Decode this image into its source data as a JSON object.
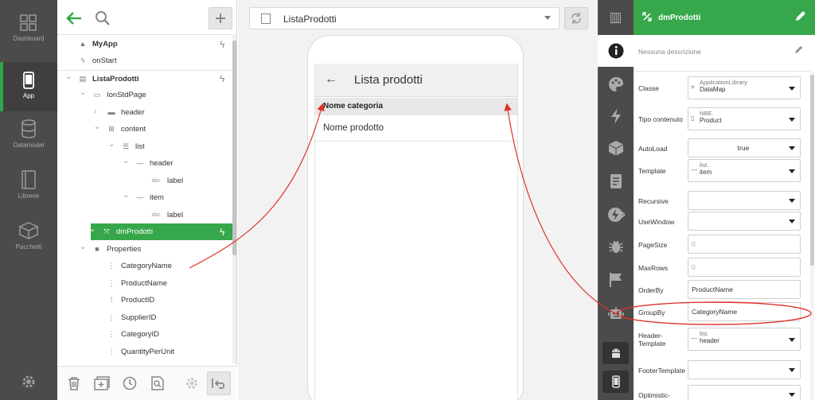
{
  "rail": {
    "items": [
      {
        "label": "Dashboard",
        "icon": "dashboard-icon"
      },
      {
        "label": "App",
        "icon": "phone-icon"
      },
      {
        "label": "Datamodel",
        "icon": "database-icon"
      },
      {
        "label": "Librerie",
        "icon": "book-icon"
      },
      {
        "label": "Pacchetti",
        "icon": "package-icon"
      }
    ],
    "active_index": 1,
    "settings_icon": "gear-icon"
  },
  "tree": {
    "nodes": [
      {
        "label": "MyApp",
        "icon": "rocket-icon",
        "bold": true,
        "badge": "lightning-doc-icon"
      },
      {
        "label": "onStart",
        "icon": "bolt-icon"
      },
      {
        "label": "ListaProdotti",
        "icon": "page-icon",
        "bold": true,
        "expanded": true,
        "badge": "lightning-doc-icon"
      },
      {
        "label": "IonStdPage",
        "icon": "frame-icon",
        "expanded": true
      },
      {
        "label": "header",
        "icon": "header-block-icon",
        "expanded": false
      },
      {
        "label": "content",
        "icon": "grid-icon",
        "expanded": true
      },
      {
        "label": "list",
        "icon": "list-icon",
        "expanded": true
      },
      {
        "label": "header",
        "icon": "dash-icon",
        "expanded": true
      },
      {
        "label": "label",
        "icon": "abc-icon",
        "prefix": "abc"
      },
      {
        "label": "item",
        "icon": "dash-icon",
        "expanded": true
      },
      {
        "label": "label",
        "icon": "abc-icon",
        "prefix": "abc"
      },
      {
        "label": "dmProdotti",
        "icon": "datamap-icon",
        "selected": true,
        "expanded": true,
        "badge": "lightning-doc-icon"
      },
      {
        "label": "Properties",
        "icon": "folder-icon",
        "expanded": true
      },
      {
        "label": "CategoryName",
        "icon": "field-icon"
      },
      {
        "label": "ProductName",
        "icon": "field-icon"
      },
      {
        "label": "ProductID",
        "icon": "key-field-icon"
      },
      {
        "label": "SupplierID",
        "icon": "field-icon"
      },
      {
        "label": "CategoryID",
        "icon": "field-icon"
      },
      {
        "label": "QuantityPerUnit",
        "icon": "field-icon"
      }
    ],
    "bottom_icons": [
      "trash-icon",
      "add-library-icon",
      "history-icon",
      "search-doc-icon",
      "gear-icon",
      "undo-icon"
    ]
  },
  "center": {
    "page_select": "ListaProdotti",
    "phone": {
      "title": "Lista prodotti",
      "group_header": "Nome categoria",
      "item": "Nome prodotto"
    }
  },
  "props": {
    "header_title": "dmProdotti",
    "description_placeholder": "Nessuna descrizione",
    "rows": [
      {
        "label": "Classe",
        "small": "ApplicationLibrary.",
        "main": "DataMap",
        "icon": "#",
        "dropdown": true
      },
      {
        "label": "Tipo contenuto",
        "small": "NBE.",
        "main": "Product",
        "icon": "doc",
        "dropdown": true
      },
      {
        "label": "AutoLoad",
        "value": "true",
        "dropdown": true,
        "center": true
      },
      {
        "label": "Template",
        "small": "list.",
        "main": "item",
        "icon": "dash",
        "dropdown": true
      },
      {
        "label": "Recursive",
        "value": "",
        "dropdown": true
      },
      {
        "label": "UseWindow",
        "value": "",
        "dropdown": true
      },
      {
        "label": "PageSize",
        "value": "0",
        "placeholder": true
      },
      {
        "label": "MaxRows",
        "value": "0",
        "placeholder": true
      },
      {
        "label": "OrderBy",
        "value": "ProductName"
      },
      {
        "label": "GroupBy",
        "value": "CategoryName"
      },
      {
        "label": "Header-\nTemplate",
        "small": "list.",
        "main": "header",
        "icon": "dash",
        "dropdown": true
      },
      {
        "label": "FooterTemplate",
        "value": "",
        "dropdown": true
      },
      {
        "label": "Optimistic-",
        "value": "",
        "dropdown": true
      }
    ]
  },
  "colors": {
    "accent_green": "#36a84b",
    "annotation_red": "#e0322a",
    "dark_rail": "#4b4b4b"
  }
}
